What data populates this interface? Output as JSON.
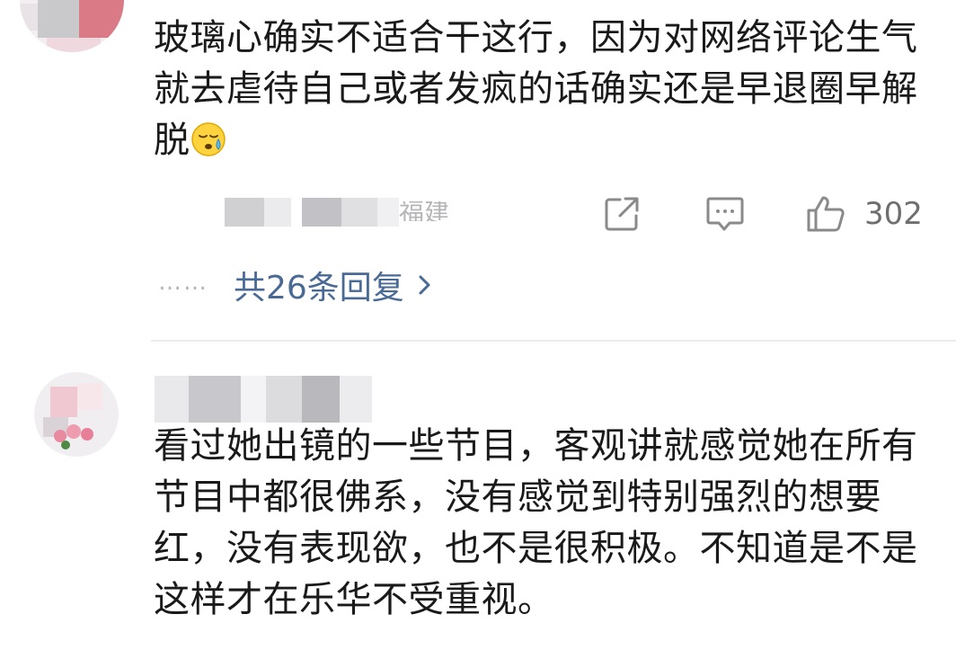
{
  "comments": [
    {
      "text": "玻璃心确实不适合干这行，因为对网络评论生气就去虐待自己或者发疯的话确实还是早退圈早解脱",
      "emoji": "sweat-emoji",
      "location_fragment": "福建",
      "actions": {
        "share_icon": "share-icon",
        "comment_icon": "comment-icon",
        "like_icon": "thumbs-up-icon",
        "like_count": "302"
      },
      "replies": {
        "ellipsis": "……",
        "label": "共26条回复",
        "chevron_icon": "chevron-right-icon"
      }
    },
    {
      "text": "看过她出镜的一些节目，客观讲就感觉她在所有节目中都很佛系，没有感觉到特别强烈的想要红，没有表现欲，也不是很积极。不知道是不是这样才在乐华不受重视。"
    }
  ],
  "colors": {
    "text": "#1a1a1a",
    "link": "#4a6a96",
    "icon": "#8a8a8a",
    "divider": "#ececec"
  }
}
